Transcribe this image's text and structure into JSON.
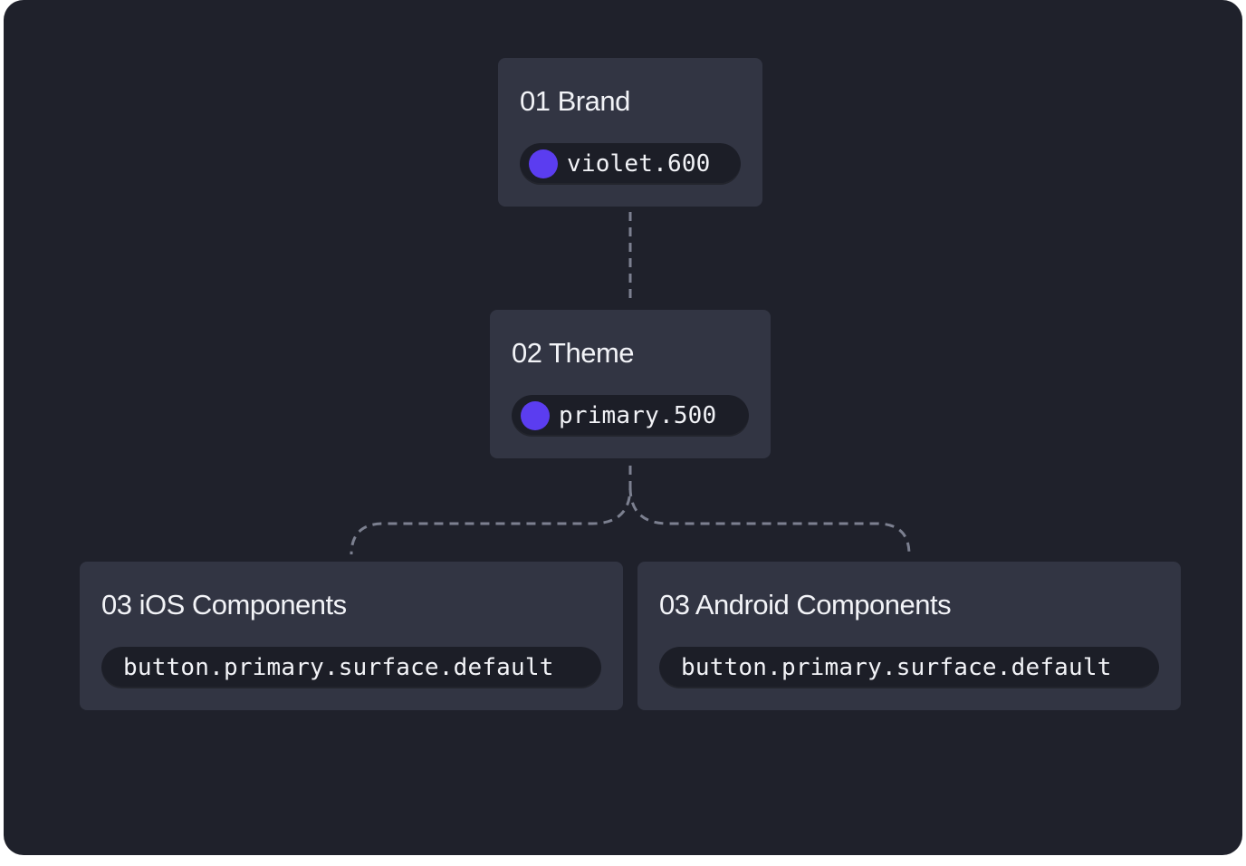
{
  "nodes": {
    "brand": {
      "title": "01 Brand",
      "token": "violet.600",
      "swatch_color": "#5b3df0"
    },
    "theme": {
      "title": "02 Theme",
      "token": "primary.500",
      "swatch_color": "#5b3df0"
    },
    "ios": {
      "title": "03 iOS Components",
      "token": "button.primary.surface.default"
    },
    "android": {
      "title": "03 Android Components",
      "token": "button.primary.surface.default"
    }
  },
  "colors": {
    "background": "#1f212b",
    "card": "#323543",
    "token_pill": "#1c1e27",
    "connector": "#7c8090",
    "text": "#f2f3f7"
  }
}
